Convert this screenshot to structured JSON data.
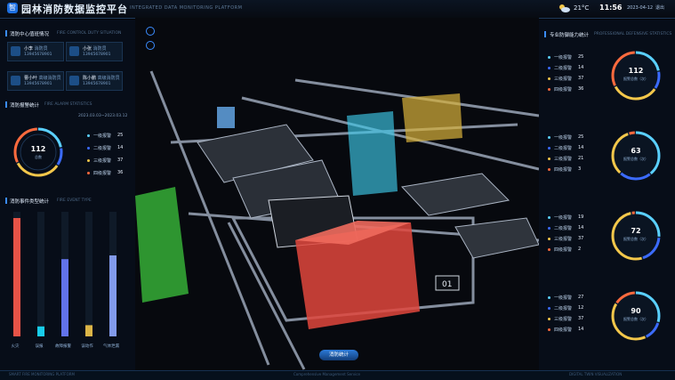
{
  "header": {
    "logo": "智",
    "title": "园林消防数据监控平台",
    "subtitle": "INTEGRATED DATA MONITORING PLATFORM",
    "temperature": "21°C",
    "time": "11:56",
    "date": "2023-04-12",
    "exit": "退出"
  },
  "left": {
    "duty": {
      "title": "消防中心值班情况",
      "sub": "FIRE CONTROL DUTY SITUATION",
      "people": [
        {
          "name": "小李",
          "role": "消防员",
          "phone": "13945678901"
        },
        {
          "name": "小张",
          "role": "消防员",
          "phone": "13945678901"
        },
        {
          "name": "曹小叶",
          "role": "高级消防员",
          "phone": "13945678901"
        },
        {
          "name": "陈小鹏",
          "role": "高级消防员",
          "phone": "13945678901"
        }
      ]
    },
    "alarm": {
      "title": "消防报警统计",
      "sub": "FIRE ALARM STATISTICS",
      "range": "2023.03.03~2023.03.12",
      "total": "112",
      "total_label": "总数",
      "items": [
        {
          "label": "一级报警",
          "value": "25",
          "color": "#5ad0ff"
        },
        {
          "label": "二级报警",
          "value": "14",
          "color": "#3b6bff"
        },
        {
          "label": "三级报警",
          "value": "37",
          "color": "#f3c74a"
        },
        {
          "label": "四级报警",
          "value": "36",
          "color": "#ff6a3d"
        }
      ]
    },
    "events": {
      "title": "消防事件类型统计",
      "sub": "FIRE EVENT TYPE",
      "bars": [
        {
          "label": "火灾",
          "value": 95,
          "color": "#ff5a4a"
        },
        {
          "label": "误报",
          "value": 8,
          "color": "#19e0ff"
        },
        {
          "label": "故障报警",
          "value": 62,
          "color": "#6c7dff"
        },
        {
          "label": "误动作",
          "value": 9,
          "color": "#f3c74a"
        },
        {
          "label": "气体泄漏",
          "value": 65,
          "color": "#8fa8ff"
        }
      ],
      "ymax": 100
    }
  },
  "right": {
    "title": "专业防御能力统计",
    "sub": "PROFESSIONAL DEFENSIVE STATISTICS",
    "groups": [
      {
        "total": "112",
        "label": "报警总数（次）",
        "items": [
          {
            "label": "一级报警",
            "value": "25",
            "color": "#5ad0ff"
          },
          {
            "label": "二级报警",
            "value": "14",
            "color": "#3b6bff"
          },
          {
            "label": "三级报警",
            "value": "37",
            "color": "#f3c74a"
          },
          {
            "label": "四级报警",
            "value": "36",
            "color": "#ff6a3d"
          }
        ]
      },
      {
        "total": "63",
        "label": "报警总数（次）",
        "items": [
          {
            "label": "一级报警",
            "value": "25",
            "color": "#5ad0ff"
          },
          {
            "label": "二级报警",
            "value": "14",
            "color": "#3b6bff"
          },
          {
            "label": "三级报警",
            "value": "21",
            "color": "#f3c74a"
          },
          {
            "label": "四级报警",
            "value": "3",
            "color": "#ff6a3d"
          }
        ]
      },
      {
        "total": "72",
        "label": "报警总数（次）",
        "items": [
          {
            "label": "一级报警",
            "value": "19",
            "color": "#5ad0ff"
          },
          {
            "label": "二级报警",
            "value": "14",
            "color": "#3b6bff"
          },
          {
            "label": "三级报警",
            "value": "37",
            "color": "#f3c74a"
          },
          {
            "label": "四级报警",
            "value": "2",
            "color": "#ff6a3d"
          }
        ]
      },
      {
        "total": "90",
        "label": "报警总数（次）",
        "items": [
          {
            "label": "一级报警",
            "value": "27",
            "color": "#5ad0ff"
          },
          {
            "label": "二级报警",
            "value": "12",
            "color": "#3b6bff"
          },
          {
            "label": "三级报警",
            "value": "37",
            "color": "#f3c74a"
          },
          {
            "label": "四级报警",
            "value": "14",
            "color": "#ff6a3d"
          }
        ]
      }
    ]
  },
  "center": {
    "button": "消防统计",
    "building_code": "01"
  },
  "footer": {
    "left": "SMART FIRE MONITORING PLATFORM",
    "mid": "Comprehensive Management Service",
    "right": "DIGITAL TWIN VISUALIZATION"
  }
}
